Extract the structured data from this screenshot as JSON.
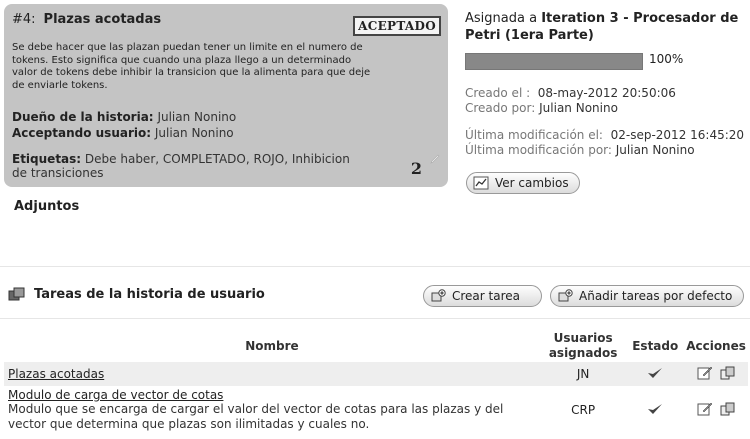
{
  "story": {
    "number": "#4:",
    "title": "Plazas acotadas",
    "status": "ACEPTADO",
    "description": "Se debe hacer que las plazan puedan tener un limite en el numero de tokens. Esto significa que cuando una plaza llego a un determinado valor de tokens debe inhibir la transicion que la alimenta para que deje de enviarle tokens.",
    "owner_label": "Dueño de la historia:",
    "owner_value": "Julian Nonino",
    "accepting_label": "Acceptando usuario:",
    "accepting_value": "Julian Nonino",
    "tags_label": "Etiquetas:",
    "tags_value": "Debe haber, COMPLETADO, ROJO, Inhibicion de transiciones",
    "points": "2"
  },
  "assignment": {
    "prefix": "Asignada a",
    "iteration": "Iteration 3 - Procesador de Petri (1era Parte)",
    "progress": 1.0,
    "progress_text": "100%",
    "created_at_label": "Creado el :",
    "created_at": "08-may-2012 20:50:06",
    "created_by_label": "Creado por:",
    "created_by": "Julian Nonino",
    "modified_at_label": "Última modificación el:",
    "modified_at": "02-sep-2012 16:45:20",
    "modified_by_label": "Última modificación por:",
    "modified_by": "Julian Nonino",
    "view_changes_label": "Ver cambios"
  },
  "attachments": {
    "title": "Adjuntos"
  },
  "tasks": {
    "title": "Tareas de la historia de usuario",
    "create_label": "Crear tarea",
    "add_default_label": "Añadir tareas por defecto",
    "columns": {
      "name": "Nombre",
      "users": "Usuarios asignados",
      "state": "Estado",
      "actions": "Acciones"
    },
    "rows": [
      {
        "name": "Plazas acotadas",
        "desc": "",
        "users": "JN"
      },
      {
        "name": "Modulo de carga de vector de cotas",
        "desc": "Modulo que se encarga de cargar el valor del vector de cotas para las plazas y del vector que determina que plazas son ilimitadas y cuales no.",
        "users": "CRP"
      }
    ]
  }
}
